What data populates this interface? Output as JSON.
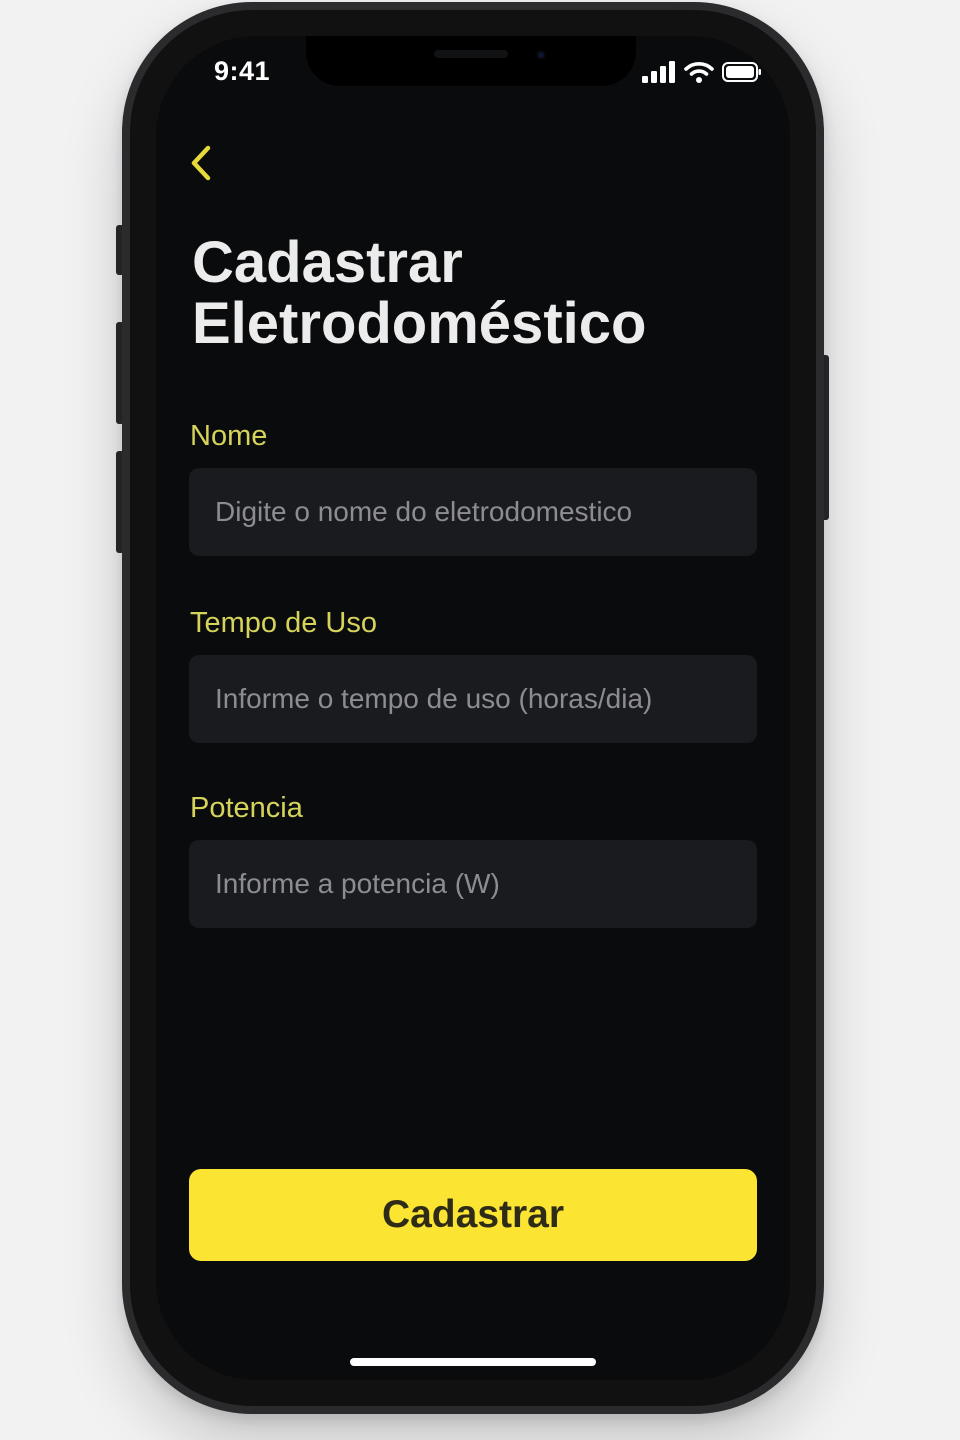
{
  "status_bar": {
    "time": "9:41",
    "icons": [
      "cellular-signal-icon",
      "wifi-icon",
      "battery-icon"
    ]
  },
  "header": {
    "back_icon": "chevron-left-icon",
    "title_line1": "Cadastrar",
    "title_line2": "Eletrodoméstico"
  },
  "form": {
    "nome": {
      "label": "Nome",
      "placeholder": "Digite o nome do eletrodomestico",
      "value": ""
    },
    "tempo": {
      "label": "Tempo de Uso",
      "placeholder": "Informe o tempo de uso (horas/dia)",
      "value": ""
    },
    "potencia": {
      "label": "Potencia",
      "placeholder": "Informe a potencia (W)",
      "value": ""
    }
  },
  "submit": {
    "label": "Cadastrar"
  },
  "colors": {
    "accent": "#fce433",
    "label": "#d6d35a",
    "background": "#0a0b0d",
    "field_bg": "#1a1b1e"
  }
}
